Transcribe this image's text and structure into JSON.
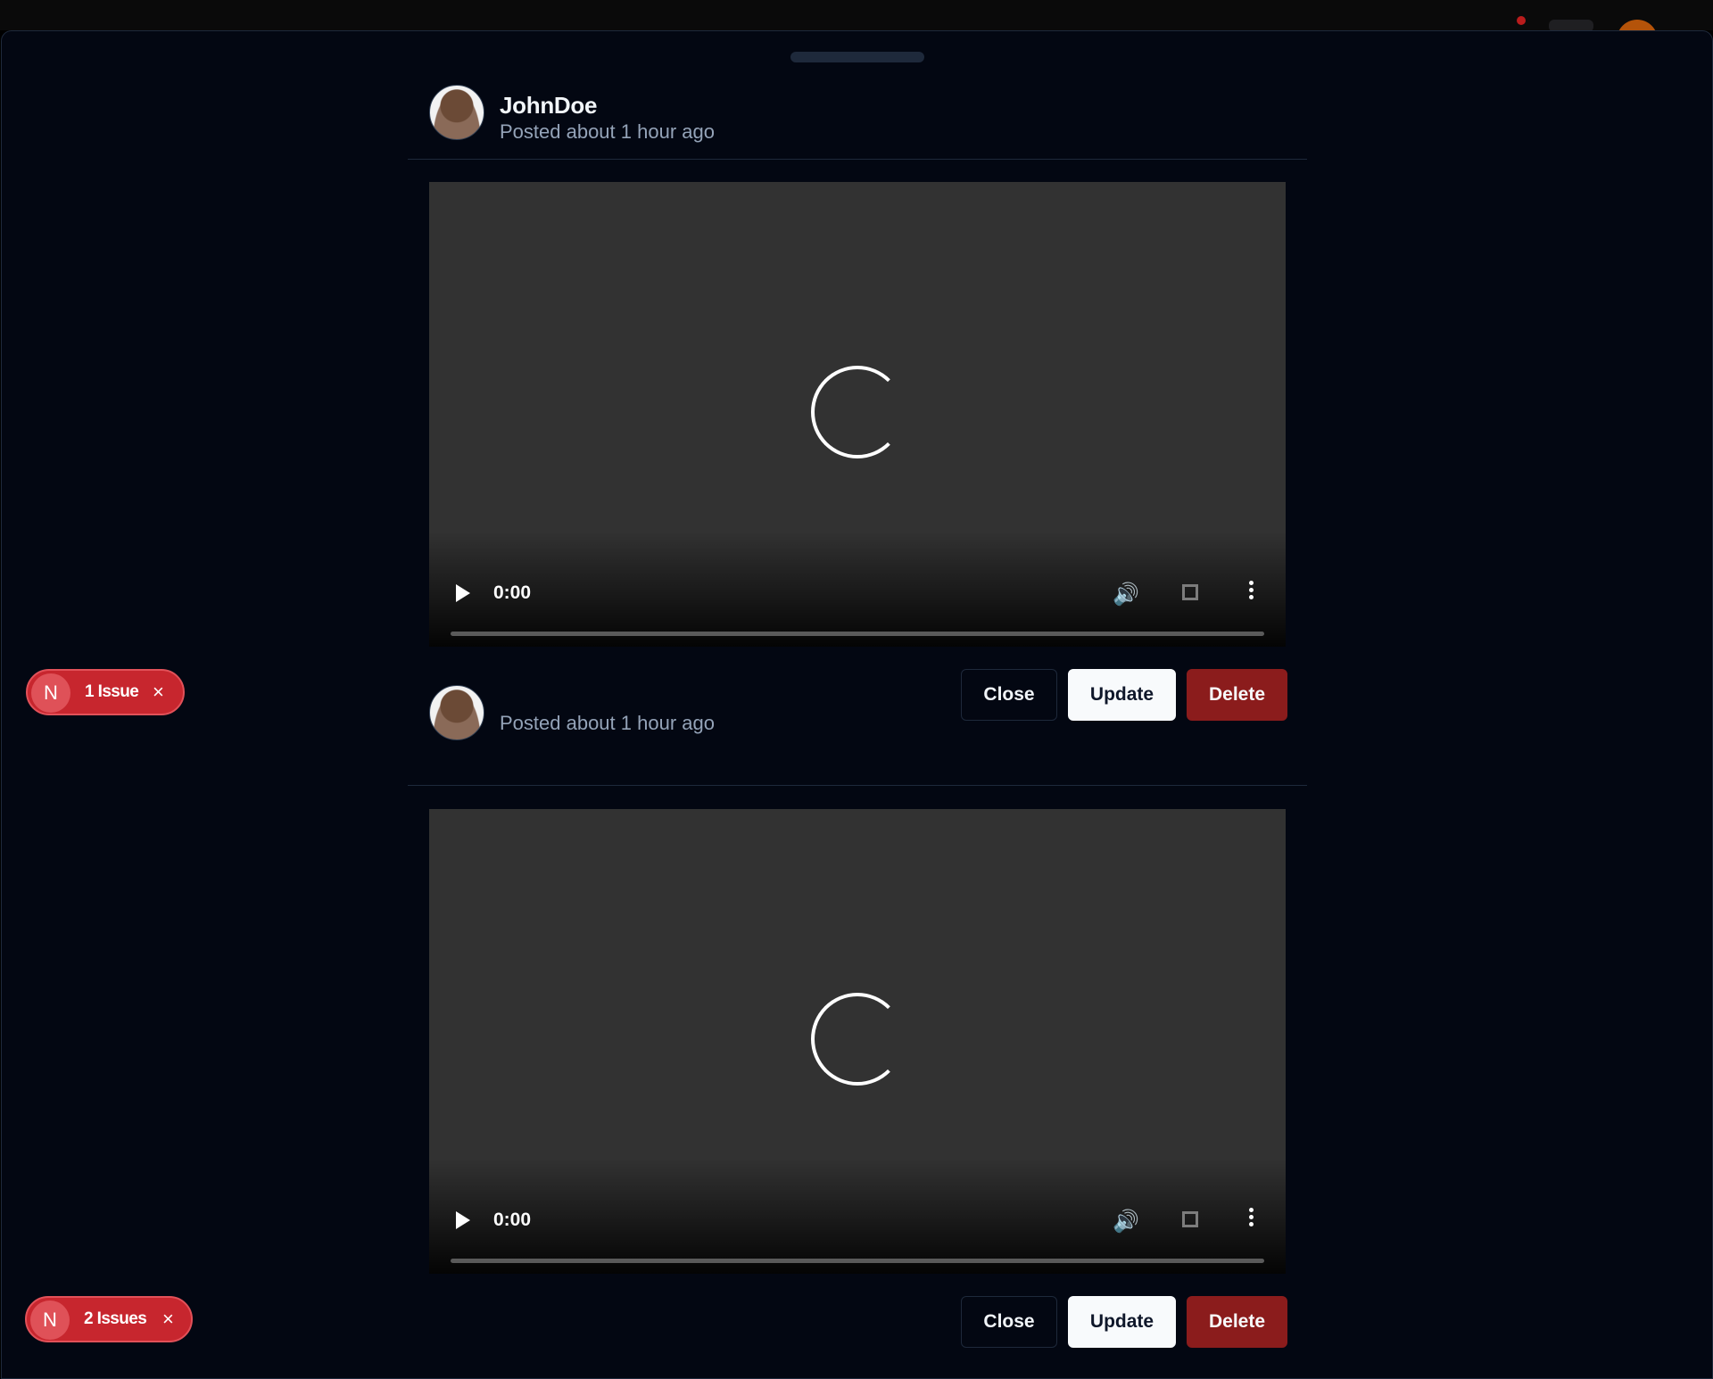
{
  "posts": [
    {
      "username": "JohnDoe",
      "posted": "Posted about 1 hour ago",
      "video": {
        "time": "0:00"
      },
      "actions": {
        "close": "Close",
        "update": "Update",
        "delete": "Delete"
      }
    },
    {
      "username": "",
      "posted": "Posted about 1 hour ago",
      "video": {
        "time": "0:00"
      },
      "actions": {
        "close": "Close",
        "update": "Update",
        "delete": "Delete"
      }
    }
  ],
  "issue_badges": [
    {
      "logo": "N",
      "label": "1 Issue",
      "close_icon": "×"
    },
    {
      "logo": "N",
      "label": "2 Issues",
      "close_icon": "×"
    }
  ],
  "icons": {
    "play": "play-icon",
    "volume": "🔊",
    "fullscreen": "fullscreen-icon",
    "more": "more-vertical-icon"
  },
  "colors": {
    "background": "#030712",
    "delete": "#8b1c1c",
    "issue_badge": "#c7262e"
  }
}
